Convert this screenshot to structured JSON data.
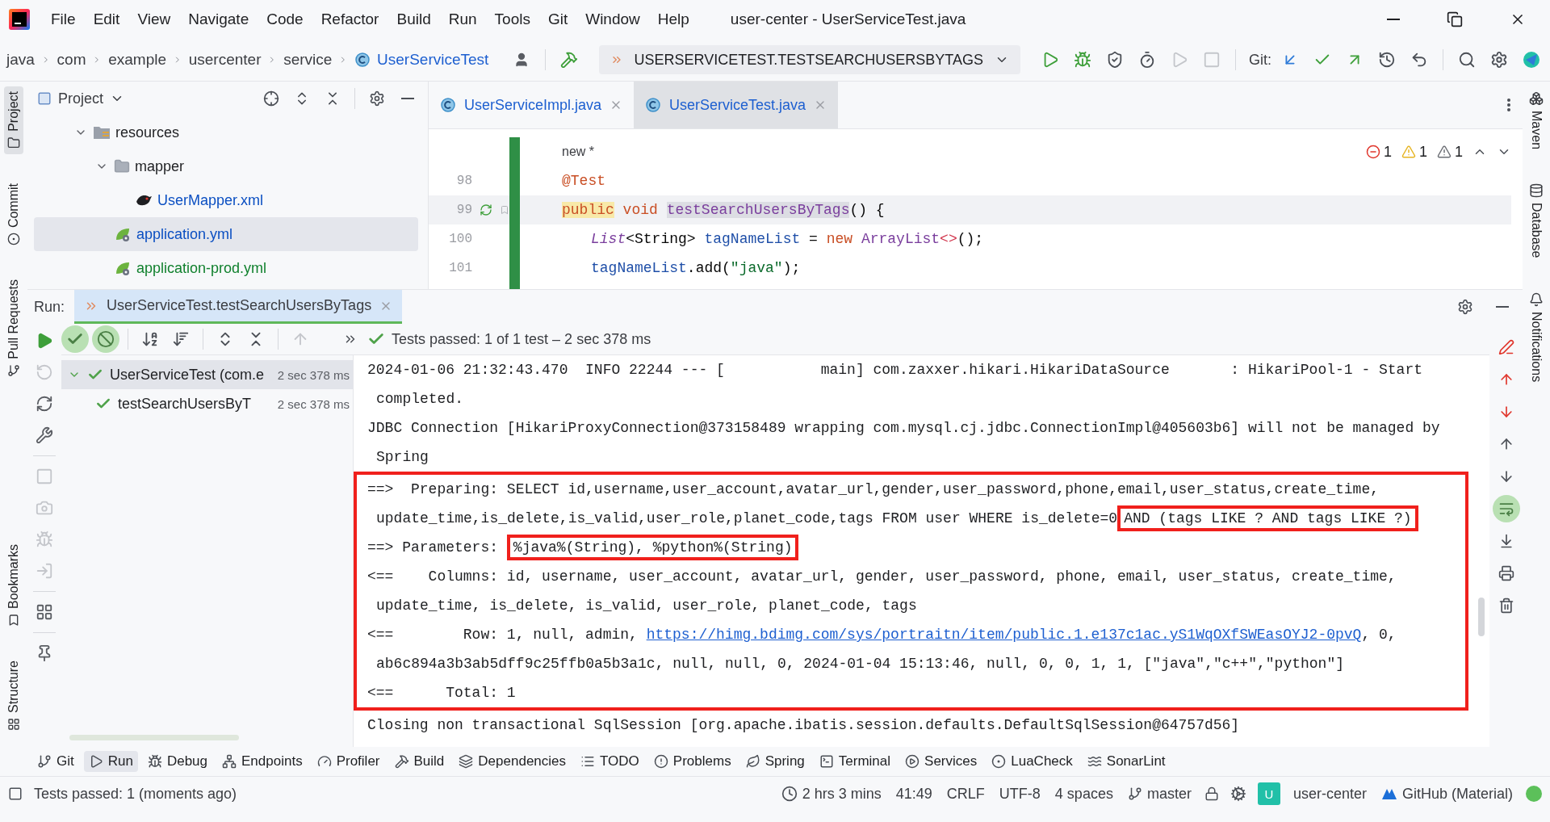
{
  "menu_bar": {
    "items": [
      "File",
      "Edit",
      "View",
      "Navigate",
      "Code",
      "Refactor",
      "Build",
      "Run",
      "Tools",
      "Git",
      "Window",
      "Help"
    ],
    "title": "user-center - UserServiceTest.java"
  },
  "nav_bar": {
    "breadcrumbs": [
      "java",
      "com",
      "example",
      "usercenter",
      "service",
      "UserServiceTest"
    ],
    "run_config": "USERSERVICETEST.TESTSEARCHUSERSBYTAGS",
    "actions": [
      {
        "disabled": false
      },
      {
        "disabled": false
      },
      {
        "disabled": false
      },
      {
        "disabled": false
      },
      {
        "disabled": true
      },
      {
        "disabled": true
      }
    ],
    "git_label": "Git:"
  },
  "left_stripe": {
    "top": [
      {
        "label": "Project",
        "selected": true
      },
      {
        "label": "Commit",
        "selected": false
      },
      {
        "label": "Pull Requests",
        "selected": false
      }
    ],
    "bottom": [
      {
        "label": "Bookmarks",
        "selected": false
      },
      {
        "label": "Structure",
        "selected": false
      }
    ]
  },
  "right_stripe": [
    {
      "label": "Maven"
    },
    {
      "label": "Database"
    },
    {
      "label": "Notifications"
    }
  ],
  "project": {
    "title": "Project",
    "tree": [
      {
        "label": "resources",
        "kind": "resources",
        "expanded": true,
        "selected": false,
        "color": "#1e1f22",
        "children": [
          {
            "label": "mapper",
            "kind": "folder",
            "expanded": true,
            "selected": false,
            "color": "#1e1f22",
            "children": [
              {
                "label": "UserMapper.xml",
                "kind": "xml",
                "selected": false,
                "color": "#0b4fc2"
              }
            ]
          },
          {
            "label": "application.yml",
            "kind": "yml",
            "selected": true,
            "color": "#0b4fc2"
          },
          {
            "label": "application-prod.yml",
            "kind": "yml",
            "selected": false,
            "color": "#11812e"
          }
        ]
      }
    ]
  },
  "editor": {
    "tabs": [
      {
        "label": "UserServiceImpl.java",
        "selected": false
      },
      {
        "label": "UserServiceTest.java",
        "selected": true
      }
    ],
    "author_hint": "new *",
    "problems": {
      "errors": "1",
      "warnings": "1",
      "weak_warnings": "1"
    },
    "lines": [
      {
        "number": "98",
        "current": false,
        "runnable": false,
        "indented": false,
        "tokens": [
          {
            "text": "@Test",
            "kind": "annotation",
            "highlighted": false
          }
        ]
      },
      {
        "number": "99",
        "current": true,
        "runnable": true,
        "indented": false,
        "tokens": [
          {
            "text": "public",
            "kind": "keyword",
            "highlighted": true
          },
          {
            "text": " void ",
            "kind": "keyword",
            "highlighted": false
          },
          {
            "text": "testSearchUsersByTags",
            "kind": "method",
            "highlighted": true
          },
          {
            "text": "() {",
            "kind": "plain",
            "highlighted": false
          }
        ]
      },
      {
        "number": "100",
        "current": false,
        "runnable": false,
        "indented": true,
        "tokens": [
          {
            "text": "List",
            "kind": "interface",
            "highlighted": false
          },
          {
            "text": "<String> ",
            "kind": "plain",
            "highlighted": false
          },
          {
            "text": "tagNameList",
            "kind": "field",
            "highlighted": false
          },
          {
            "text": " = ",
            "kind": "plain",
            "highlighted": false
          },
          {
            "text": "new",
            "kind": "keyword",
            "highlighted": false
          },
          {
            "text": " ArrayList",
            "kind": "type",
            "highlighted": false
          },
          {
            "text": "<>",
            "kind": "diamond",
            "highlighted": false
          },
          {
            "text": "();",
            "kind": "plain",
            "highlighted": false
          }
        ]
      },
      {
        "number": "101",
        "current": false,
        "runnable": false,
        "indented": true,
        "tokens": [
          {
            "text": "tagNameList",
            "kind": "field",
            "highlighted": false
          },
          {
            "text": ".add(",
            "kind": "plain",
            "highlighted": false
          },
          {
            "text": "\"java\"",
            "kind": "string",
            "highlighted": false
          },
          {
            "text": ");",
            "kind": "plain",
            "highlighted": false
          }
        ]
      }
    ]
  },
  "run": {
    "label": "Run:",
    "tab": {
      "label": "UserServiceTest.testSearchUsersByTags",
      "selected": true
    },
    "side_tools": [
      {
        "disabled": false
      },
      {
        "disabled": true
      },
      {
        "disabled": false
      },
      {
        "disabled": false
      },
      {
        "disabled": true
      },
      {
        "disabled": true
      },
      {
        "disabled": true
      },
      {
        "disabled": true
      },
      {
        "disabled": false
      },
      {
        "disabled": false
      }
    ],
    "filters": [
      {
        "on": true
      },
      {
        "on": true
      }
    ],
    "status": "Tests passed: 1 of 1 test – 2 sec 378 ms",
    "tree": [
      {
        "label": "UserServiceTest (com.e",
        "time": "2 sec 378 ms",
        "expanded": true,
        "selected": true,
        "children": [
          {
            "label": "testSearchUsersByT",
            "time": "2 sec 378 ms",
            "selected": false
          }
        ]
      }
    ],
    "console": {
      "soft_wrap": true,
      "blocks": [
        {
          "framed": false,
          "lines": [
            {
              "wrapped": false,
              "segments": [
                {
                  "text": "2024-01-06 21:32:43.470  INFO 22244 --- [           main] com.zaxxer.hikari.HikariDataSource       : HikariPool-1 - Start",
                  "kind": "plain"
                }
              ]
            },
            {
              "wrapped": true,
              "segments": [
                {
                  "text": "completed.",
                  "kind": "plain"
                }
              ]
            },
            {
              "wrapped": false,
              "segments": [
                {
                  "text": "JDBC Connection [HikariProxyConnection@373158489 wrapping com.mysql.cj.jdbc.ConnectionImpl@405603b6] will not be managed by",
                  "kind": "plain"
                }
              ]
            },
            {
              "wrapped": true,
              "segments": [
                {
                  "text": "Spring",
                  "kind": "plain"
                }
              ]
            }
          ]
        },
        {
          "framed": true,
          "lines": [
            {
              "wrapped": false,
              "segments": [
                {
                  "text": "==>  Preparing: SELECT id,username,user_account,avatar_url,gender,user_password,phone,email,user_status,create_time,",
                  "kind": "plain"
                }
              ]
            },
            {
              "wrapped": true,
              "segments": [
                {
                  "text": "update_time,is_delete,is_valid,user_role,planet_code,tags FROM user WHERE is_delete=0",
                  "kind": "plain"
                },
                {
                  "text": "AND (tags LIKE ? AND tags LIKE ?)",
                  "kind": "boxed"
                }
              ]
            },
            {
              "wrapped": false,
              "segments": [
                {
                  "text": "==> Parameters: ",
                  "kind": "plain"
                },
                {
                  "text": "%java%(String), %python%(String)",
                  "kind": "boxed"
                }
              ]
            },
            {
              "wrapped": false,
              "segments": [
                {
                  "text": "<==    Columns: id, username, user_account, avatar_url, gender, user_password, phone, email, user_status, create_time,",
                  "kind": "plain"
                }
              ]
            },
            {
              "wrapped": true,
              "segments": [
                {
                  "text": "update_time, is_delete, is_valid, user_role, planet_code, tags",
                  "kind": "plain"
                }
              ]
            },
            {
              "wrapped": false,
              "segments": [
                {
                  "text": "<==        Row: 1, null, admin, ",
                  "kind": "plain"
                },
                {
                  "text": "https://himg.bdimg.com/sys/portraitn/item/public.1.e137c1ac.yS1WqOXfSWEasOYJ2-0pvQ",
                  "kind": "link"
                },
                {
                  "text": ", 0,",
                  "kind": "plain"
                }
              ]
            },
            {
              "wrapped": true,
              "segments": [
                {
                  "text": "ab6c894a3b3ab5dff9c25ffb0a5b3a1c, null, null, 0, 2024-01-04 15:13:46, null, 0, 0, 1, 1, [\"java\",\"c++\",\"python\"]",
                  "kind": "plain"
                }
              ]
            },
            {
              "wrapped": false,
              "segments": [
                {
                  "text": "<==      Total: 1",
                  "kind": "plain"
                }
              ]
            }
          ]
        },
        {
          "framed": false,
          "lines": [
            {
              "wrapped": false,
              "segments": [
                {
                  "text": "Closing non transactional SqlSession [org.apache.ibatis.session.defaults.DefaultSqlSession@64757d56]",
                  "kind": "plain"
                }
              ]
            }
          ]
        }
      ]
    }
  },
  "tool_windows": [
    {
      "label": "Git",
      "selected": false
    },
    {
      "label": "Run",
      "selected": true
    },
    {
      "label": "Debug",
      "selected": false
    },
    {
      "label": "Endpoints",
      "selected": false
    },
    {
      "label": "Profiler",
      "selected": false
    },
    {
      "label": "Build",
      "selected": false
    },
    {
      "label": "Dependencies",
      "selected": false
    },
    {
      "label": "TODO",
      "selected": false
    },
    {
      "label": "Problems",
      "selected": false
    },
    {
      "label": "Spring",
      "selected": false
    },
    {
      "label": "Terminal",
      "selected": false
    },
    {
      "label": "Services",
      "selected": false
    },
    {
      "label": "LuaCheck",
      "selected": false
    },
    {
      "label": "SonarLint",
      "selected": false
    }
  ],
  "status_bar": {
    "message": "Tests passed: 1 (moments ago)",
    "time_tracked": "2 hrs 3 mins",
    "position": "41:49",
    "line_separator": "CRLF",
    "encoding": "UTF-8",
    "indent": "4 spaces",
    "branch": "master",
    "project_badge": "U",
    "project": "user-center",
    "theme": "GitHub (Material)"
  }
}
